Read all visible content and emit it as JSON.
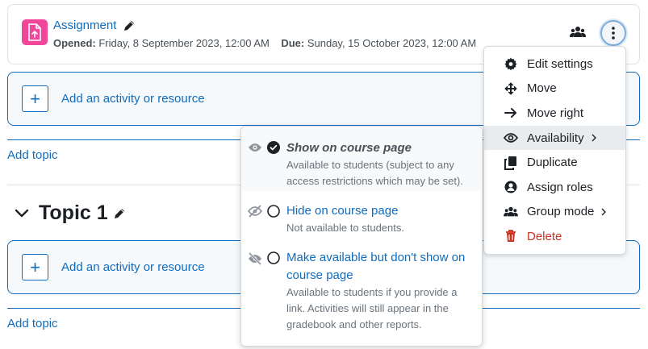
{
  "activity": {
    "title": "Assignment",
    "opened_label": "Opened:",
    "opened_value": "Friday, 8 September 2023, 12:00 AM",
    "due_label": "Due:",
    "due_value": "Sunday, 15 October 2023, 12:00 AM",
    "icon_color": "#f0479b"
  },
  "add_activity_label": "Add an activity or resource",
  "add_topic_label": "Add topic",
  "topic": {
    "title": "Topic 1"
  },
  "action_menu": {
    "items": [
      {
        "label": "Edit settings",
        "icon": "gear-icon"
      },
      {
        "label": "Move",
        "icon": "move-icon"
      },
      {
        "label": "Move right",
        "icon": "arrow-right-icon"
      },
      {
        "label": "Availability",
        "icon": "eye-icon"
      },
      {
        "label": "Duplicate",
        "icon": "copy-icon"
      },
      {
        "label": "Assign roles",
        "icon": "user-circle-icon"
      },
      {
        "label": "Group mode",
        "icon": "users-icon"
      },
      {
        "label": "Delete",
        "icon": "trash-icon"
      }
    ]
  },
  "availability": {
    "options": [
      {
        "title": "Show on course page",
        "description": "Available to students (subject to any access restrictions which may be set).",
        "selected": true
      },
      {
        "title": "Hide on course page",
        "description": "Not available to students.",
        "selected": false
      },
      {
        "title": "Make available but don't show on course page",
        "description": "Available to students if you provide a link. Activities will still appear in the gradebook and other reports.",
        "selected": false
      }
    ]
  },
  "colors": {
    "link": "#0f6cbf",
    "danger": "#ca3120",
    "border": "#dee2e6"
  }
}
